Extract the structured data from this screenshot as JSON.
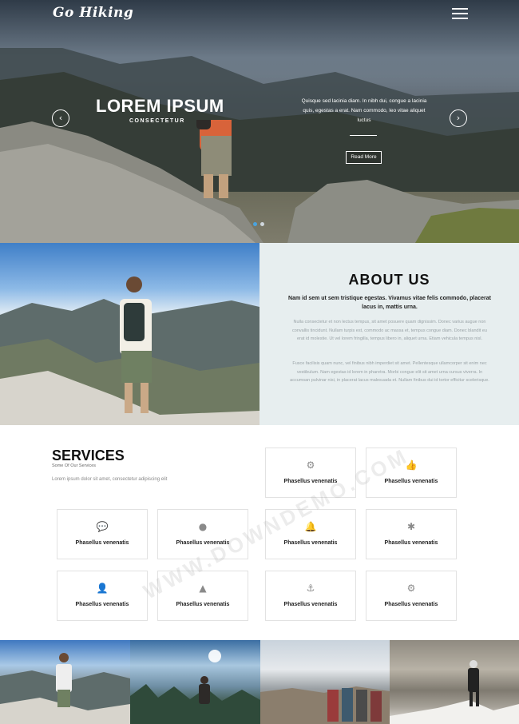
{
  "header": {
    "brand": "Go Hiking",
    "menu_icon": "hamburger-menu-icon"
  },
  "hero": {
    "title": "LOREM IPSUM",
    "subtitle": "CONSECTETUR",
    "text": "Quisque sed lacinia diam. In nibh dui, congue a lacinia quis, egestas a erat. Nam commodo, leo vitae aliquet luctus",
    "button": "Read More",
    "prev_icon": "chevron-left-icon",
    "next_icon": "chevron-right-icon",
    "slides": 2,
    "active_slide": 1
  },
  "about": {
    "title": "ABOUT US",
    "lead": "Nam id sem ut sem tristique egestas. Vivamus vitae felis commodo, placerat lacus in, mattis urna.",
    "p1": "Nulla consectetur et non lectus tempus, sit amet posuere quam dignissim. Donec varius augue non convallis tincidunt. Nullam turpis est, commodo ac massa et, tempus congue diam. Donec blandit eu erat id molestie. Ut vel lorem fringilla, tempus libero in, aliquet urna. Etiam vehicula tempus nisl.",
    "p2": "Fusce facilisis quam nunc, vel finibus nibh imperdiet sit amet. Pellentesque ullamcorper sit enim nec vestibulum. Nam egestas id lorem in pharetra. Morbi congue elit sit amet urna cursus viverra. In accumsan pulvinar nisi, in placerat lacus malesuada et. Nullam finibus dui id tortor efficitur scelerisque."
  },
  "services": {
    "title": "SERVICES",
    "subtitle": "Some Of Our Services",
    "desc": "Lorem ipsum dolor sit amet, consectetur adipiscing elit",
    "cards": [
      {
        "label": "Phasellus venenatis",
        "icon": "gears-icon",
        "glyph": "⚙"
      },
      {
        "label": "Phasellus venenatis",
        "icon": "thumbs-up-icon",
        "glyph": "👍"
      },
      {
        "label": "Phasellus venenatis",
        "icon": "comments-icon",
        "glyph": "💬"
      },
      {
        "label": "Phasellus venenatis",
        "icon": "circle-icon",
        "glyph": "●"
      },
      {
        "label": "Phasellus venenatis",
        "icon": "bell-icon",
        "glyph": "🔔"
      },
      {
        "label": "Phasellus venenatis",
        "icon": "asterisk-icon",
        "glyph": "✱"
      },
      {
        "label": "Phasellus venenatis",
        "icon": "user-icon",
        "glyph": "👤"
      },
      {
        "label": "Phasellus venenatis",
        "icon": "road-icon",
        "glyph": "▲"
      },
      {
        "label": "Phasellus venenatis",
        "icon": "anchor-icon",
        "glyph": "⚓"
      },
      {
        "label": "Phasellus venenatis",
        "icon": "cog-icon",
        "glyph": "⚙"
      }
    ]
  },
  "gallery": [
    {
      "name": "gallery-photo-hiker-mountains"
    },
    {
      "name": "gallery-photo-hiker-forest"
    },
    {
      "name": "gallery-photo-group-hikers"
    },
    {
      "name": "gallery-photo-climber-snow"
    }
  ],
  "watermark": "WWW.DOWNDEMO.COM"
}
